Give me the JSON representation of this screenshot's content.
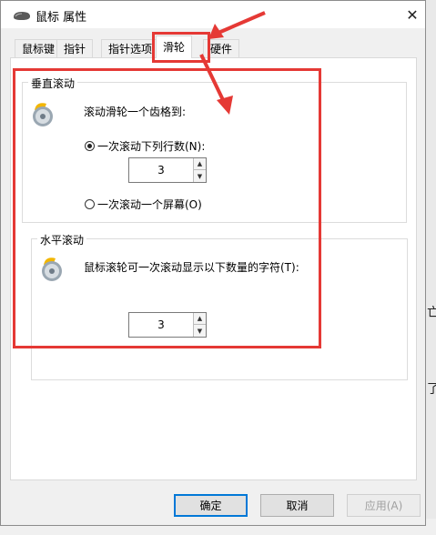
{
  "window": {
    "title": "鼠标 属性"
  },
  "tabs": [
    {
      "label": "鼠标键"
    },
    {
      "label": "指针"
    },
    {
      "label": "指针选项"
    },
    {
      "label": "滑轮"
    },
    {
      "label": "硬件"
    }
  ],
  "vertical": {
    "title": "垂直滚动",
    "description": "滚动滑轮一个齿格到:",
    "option_lines": "一次滚动下列行数(N):",
    "lines_value": "3",
    "option_screen": "一次滚动一个屏幕(O)",
    "selected": "lines"
  },
  "horizontal": {
    "title": "水平滚动",
    "description": "鼠标滚轮可一次滚动显示以下数量的字符(T):",
    "chars_value": "3"
  },
  "buttons": {
    "ok": "确定",
    "cancel": "取消",
    "apply": "应用(A)"
  },
  "background": {
    "glyph1": "亡",
    "glyph2": "了"
  },
  "colors": {
    "annotation": "#e53935",
    "accent": "#0078d7"
  }
}
